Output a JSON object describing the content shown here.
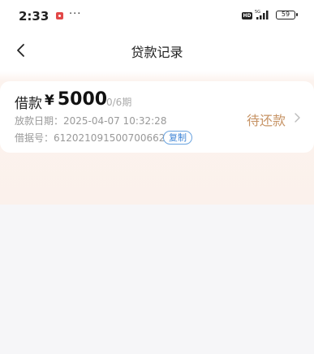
{
  "statusbar": {
    "time": "2:33",
    "dots": "···",
    "hd": "HD",
    "battery": "59"
  },
  "navbar": {
    "title": "贷款记录"
  },
  "loan": {
    "label": "借款",
    "currency": "¥",
    "amount": "5000",
    "term": "0/6期",
    "date_line": "放款日期：2025-04-07 10:32:28",
    "no_line": "借据号：612021091500700662",
    "copy_label": "复制",
    "status": "待还款"
  }
}
